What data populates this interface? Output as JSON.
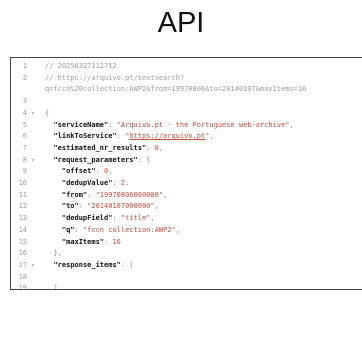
{
  "title": "API",
  "editor": {
    "lines": [
      {
        "n": "1",
        "fold": "",
        "indent": "",
        "parts": [
          {
            "t": "// 20250327112712",
            "c": "comment"
          }
        ]
      },
      {
        "n": "2",
        "fold": "",
        "indent": "",
        "parts": [
          {
            "t": "// https://arquivo.pt/textsearch?",
            "c": "comment"
          }
        ]
      },
      {
        "n": "",
        "fold": "",
        "indent": "",
        "parts": [
          {
            "t": "q=fccn%20collection:AWP2&from=19970806&to=20140107&maxItems=16",
            "c": "comment"
          }
        ]
      },
      {
        "n": "3",
        "fold": "",
        "indent": "",
        "parts": []
      },
      {
        "n": "4",
        "fold": "▾",
        "indent": "",
        "parts": [
          {
            "t": "{",
            "c": "punct"
          }
        ]
      },
      {
        "n": "5",
        "fold": "",
        "indent": "  ",
        "parts": [
          {
            "t": "\"serviceName\"",
            "c": "key"
          },
          {
            "t": ": ",
            "c": "punct"
          },
          {
            "t": "\"Arquivo.pt - the Portuguese web-archive\"",
            "c": "str"
          },
          {
            "t": ",",
            "c": "punct"
          }
        ]
      },
      {
        "n": "6",
        "fold": "",
        "indent": "  ",
        "parts": [
          {
            "t": "\"linkToService\"",
            "c": "key"
          },
          {
            "t": ": ",
            "c": "punct"
          },
          {
            "t": "\"",
            "c": "str"
          },
          {
            "t": "https://arquivo.pt",
            "c": "link"
          },
          {
            "t": "\"",
            "c": "str"
          },
          {
            "t": ",",
            "c": "punct"
          }
        ]
      },
      {
        "n": "7",
        "fold": "",
        "indent": "  ",
        "parts": [
          {
            "t": "\"estimated_nr_results\"",
            "c": "key"
          },
          {
            "t": ": ",
            "c": "punct"
          },
          {
            "t": "0",
            "c": "num"
          },
          {
            "t": ",",
            "c": "punct"
          }
        ]
      },
      {
        "n": "8",
        "fold": "▾",
        "indent": "  ",
        "parts": [
          {
            "t": "\"request_parameters\"",
            "c": "key"
          },
          {
            "t": ": {",
            "c": "punct"
          }
        ]
      },
      {
        "n": "9",
        "fold": "",
        "indent": "    ",
        "parts": [
          {
            "t": "\"offset\"",
            "c": "key"
          },
          {
            "t": ": ",
            "c": "punct"
          },
          {
            "t": "0",
            "c": "num"
          },
          {
            "t": ",",
            "c": "punct"
          }
        ]
      },
      {
        "n": "10",
        "fold": "",
        "indent": "    ",
        "parts": [
          {
            "t": "\"dedupValue\"",
            "c": "key"
          },
          {
            "t": ": ",
            "c": "punct"
          },
          {
            "t": "2",
            "c": "num"
          },
          {
            "t": ",",
            "c": "punct"
          }
        ]
      },
      {
        "n": "11",
        "fold": "",
        "indent": "    ",
        "parts": [
          {
            "t": "\"from\"",
            "c": "key"
          },
          {
            "t": ": ",
            "c": "punct"
          },
          {
            "t": "\"19970806000000\"",
            "c": "str"
          },
          {
            "t": ",",
            "c": "punct"
          }
        ]
      },
      {
        "n": "12",
        "fold": "",
        "indent": "    ",
        "parts": [
          {
            "t": "\"to\"",
            "c": "key"
          },
          {
            "t": ": ",
            "c": "punct"
          },
          {
            "t": "\"20140107000000\"",
            "c": "str"
          },
          {
            "t": ",",
            "c": "punct"
          }
        ]
      },
      {
        "n": "13",
        "fold": "",
        "indent": "    ",
        "parts": [
          {
            "t": "\"dedupField\"",
            "c": "key"
          },
          {
            "t": ": ",
            "c": "punct"
          },
          {
            "t": "\"title\"",
            "c": "str"
          },
          {
            "t": ",",
            "c": "punct"
          }
        ]
      },
      {
        "n": "14",
        "fold": "",
        "indent": "    ",
        "parts": [
          {
            "t": "\"q\"",
            "c": "key"
          },
          {
            "t": ": ",
            "c": "punct"
          },
          {
            "t": "\"fccn collection:AWP2\"",
            "c": "str"
          },
          {
            "t": ",",
            "c": "punct"
          }
        ]
      },
      {
        "n": "15",
        "fold": "",
        "indent": "    ",
        "parts": [
          {
            "t": "\"maxItems\"",
            "c": "key"
          },
          {
            "t": ": ",
            "c": "punct"
          },
          {
            "t": "16",
            "c": "num"
          }
        ]
      },
      {
        "n": "16",
        "fold": "",
        "indent": "  ",
        "parts": [
          {
            "t": "},",
            "c": "punct"
          }
        ]
      },
      {
        "n": "17",
        "fold": "▾",
        "indent": "  ",
        "parts": [
          {
            "t": "\"response_items\"",
            "c": "key"
          },
          {
            "t": ": [",
            "c": "punct"
          }
        ]
      },
      {
        "n": "18",
        "fold": "",
        "indent": "",
        "parts": []
      },
      {
        "n": "19",
        "fold": "",
        "indent": "  ",
        "parts": [
          {
            "t": "]",
            "c": "punct"
          }
        ]
      }
    ]
  }
}
